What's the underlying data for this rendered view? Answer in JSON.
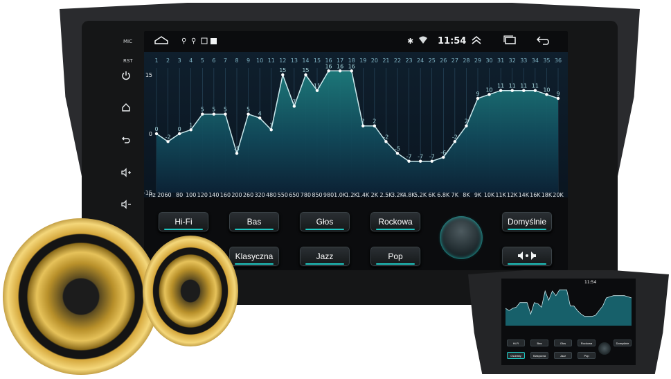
{
  "side_panel": {
    "mic_label": "MIC",
    "rst_label": "RST",
    "icons": [
      "power-icon",
      "home-icon",
      "back-icon",
      "volume-up-icon",
      "volume-down-icon"
    ]
  },
  "status_bar": {
    "time": "11:54",
    "left_icons": [
      "home-outline-icon",
      "usb-icon",
      "usb-icon",
      "image-icon",
      "square-icon"
    ],
    "right_icons": [
      "bluetooth-icon",
      "wifi-icon",
      "chevron-up-icon",
      "recent-apps-icon",
      "back-arrow-icon"
    ]
  },
  "equalizer": {
    "band_numbers": [
      "1",
      "2",
      "3",
      "4",
      "5",
      "6",
      "7",
      "8",
      "9",
      "10",
      "11",
      "12",
      "13",
      "14",
      "15",
      "16",
      "17",
      "18",
      "19",
      "20",
      "21",
      "22",
      "23",
      "24",
      "25",
      "26",
      "27",
      "28",
      "29",
      "30",
      "31",
      "32",
      "33",
      "34",
      "35",
      "36"
    ],
    "freq_labels": [
      "Hz 20",
      "60",
      "80",
      "100",
      "120",
      "140",
      "160",
      "200",
      "260",
      "320",
      "480",
      "550",
      "650",
      "780",
      "850",
      "980",
      "1.0K",
      "1.2K",
      "1.4K",
      "2K",
      "2.5K",
      "3.2K",
      "4.8K",
      "5.2K",
      "6K",
      "6.8K",
      "7K",
      "8K",
      "9K",
      "10K",
      "11K",
      "12K",
      "14K",
      "16K",
      "18K",
      "20K"
    ],
    "values": [
      0,
      -2,
      0,
      1,
      5,
      5,
      5,
      -5,
      5,
      4,
      1,
      15,
      7,
      15,
      11,
      16,
      16,
      16,
      2,
      2,
      -2,
      -5,
      -7,
      -7,
      -7,
      -6,
      -2,
      2,
      9,
      10,
      11,
      11,
      11,
      11,
      10,
      9
    ],
    "y_labels": [
      "15",
      "0",
      "-15"
    ],
    "y_range": [
      -15,
      15
    ],
    "colors": {
      "line": "#c9e8ec",
      "fill_top": "#1a6f73",
      "fill_bottom": "#0f2a3c",
      "grid": "#2c4d63"
    }
  },
  "presets": {
    "hifi": "Hi-Fi",
    "bas": "Bas",
    "glos": "Głos",
    "rockowa": "Rockowa",
    "domyslnie": "Domyślnie",
    "klasyczna": "Klasyczna",
    "jazz": "Jazz",
    "pop": "Pop"
  },
  "mini_device": {
    "time": "11:54",
    "row1": [
      "Hi-Fi",
      "Bas",
      "Głos",
      "Rockowa",
      "Domyślnie"
    ],
    "row2": [
      "Osobisty",
      "Klasyczna",
      "Jazz",
      "Pop"
    ]
  },
  "colors": {
    "accent": "#1fc7c2",
    "gold": "#c99a1f",
    "bezel": "#2a2b2e"
  }
}
